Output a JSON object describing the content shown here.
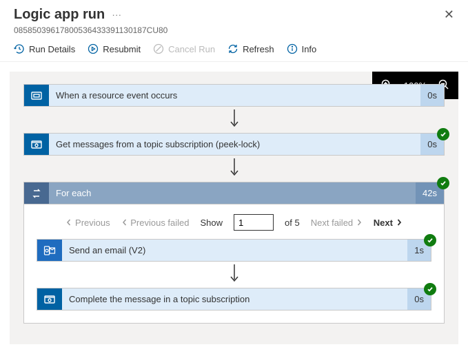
{
  "header": {
    "title": "Logic app run",
    "run_id": "0858503961780053643339113018​7CU80"
  },
  "toolbar": {
    "run_details": "Run Details",
    "resubmit": "Resubmit",
    "cancel_run": "Cancel Run",
    "refresh": "Refresh",
    "info": "Info"
  },
  "zoom": {
    "level": "100%"
  },
  "steps": {
    "s1": {
      "title": "When a resource event occurs",
      "duration": "0s"
    },
    "s2": {
      "title": "Get messages from a topic subscription (peek-lock)",
      "duration": "0s"
    },
    "s3": {
      "title": "For each",
      "duration": "42s"
    },
    "s4": {
      "title": "Send an email (V2)",
      "duration": "1s"
    },
    "s5": {
      "title": "Complete the message in a topic subscription",
      "duration": "0s"
    }
  },
  "pager": {
    "previous": "Previous",
    "previous_failed": "Previous failed",
    "show": "Show",
    "current": "1",
    "of_total": "of 5",
    "next_failed": "Next failed",
    "next": "Next"
  }
}
